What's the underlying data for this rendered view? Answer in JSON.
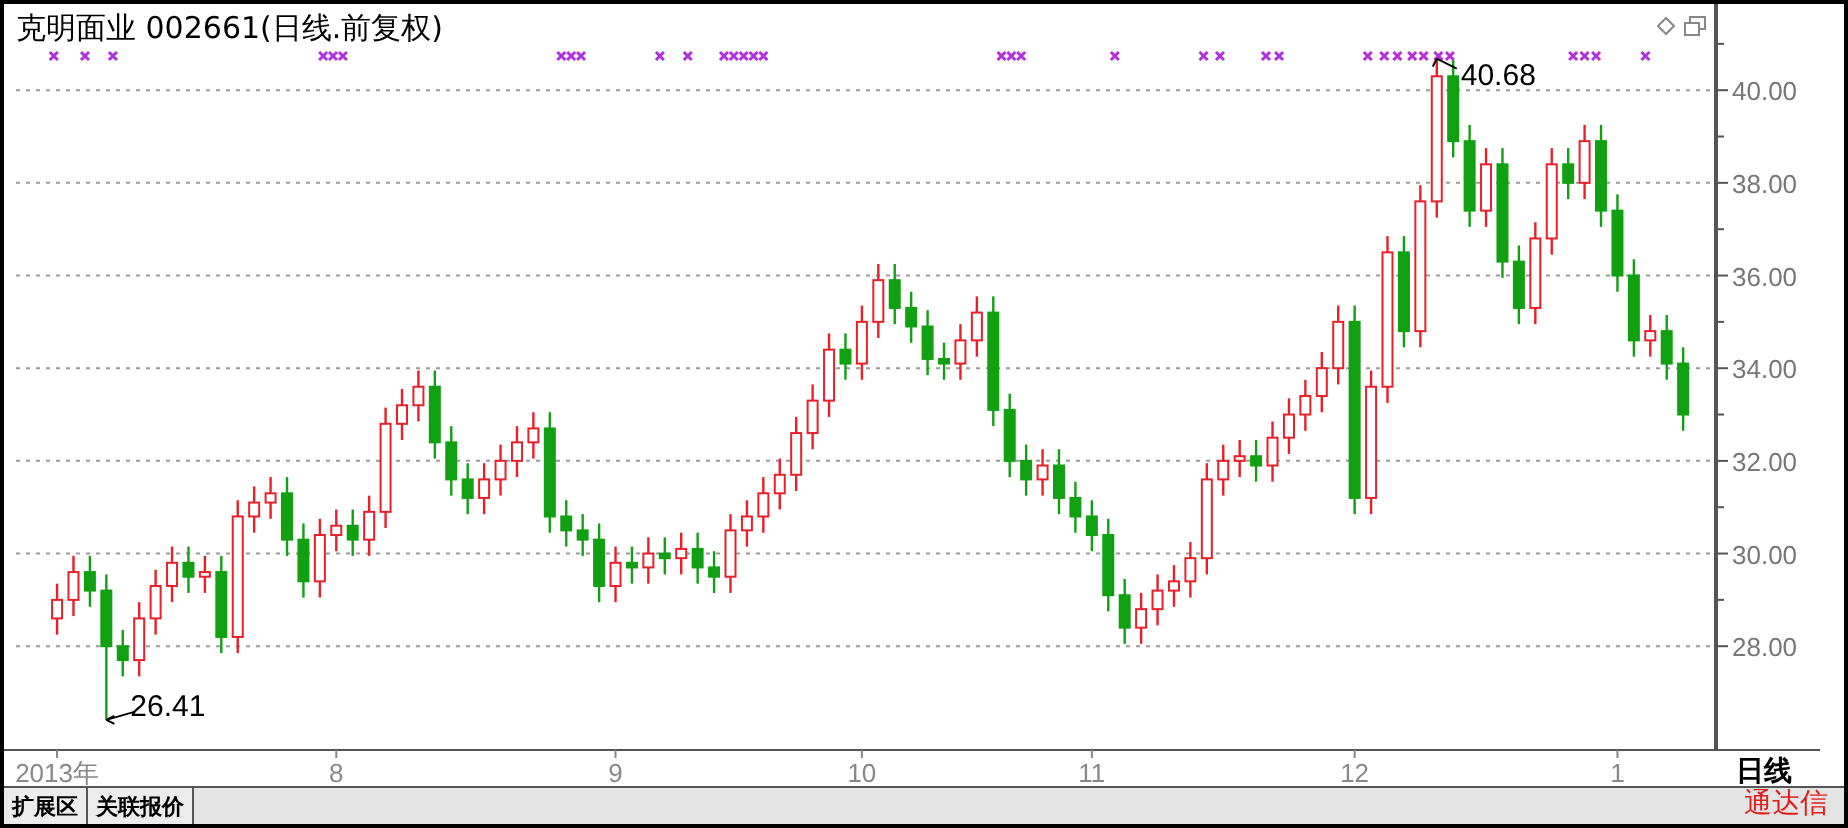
{
  "chart": {
    "title": "克明面业 002661(日线.前复权)",
    "chart_data": {
      "type": "candlestick",
      "grid": true,
      "ylim": [
        25.76,
        41.86
      ],
      "categories": [
        "2013年",
        null,
        null,
        null,
        null,
        null,
        null,
        null,
        null,
        null,
        null,
        null,
        null,
        null,
        null,
        null,
        null,
        "8",
        null,
        null,
        null,
        null,
        null,
        null,
        null,
        null,
        null,
        null,
        null,
        null,
        null,
        null,
        null,
        null,
        "9",
        null,
        null,
        null,
        null,
        null,
        null,
        null,
        null,
        null,
        null,
        null,
        null,
        null,
        null,
        "10",
        null,
        null,
        null,
        null,
        null,
        null,
        null,
        null,
        null,
        null,
        null,
        null,
        null,
        "11",
        null,
        null,
        null,
        null,
        null,
        null,
        null,
        null,
        null,
        null,
        null,
        null,
        null,
        null,
        null,
        "12",
        null,
        null,
        null,
        null,
        null,
        null,
        null,
        null,
        null,
        null,
        null,
        null,
        null,
        null,
        null,
        "1",
        null,
        null,
        null,
        null
      ],
      "ohlc": [
        [
          28.6,
          29.35,
          28.25,
          29.0
        ],
        [
          29.0,
          29.95,
          28.65,
          29.6
        ],
        [
          29.6,
          29.95,
          28.85,
          29.2
        ],
        [
          29.2,
          29.55,
          26.41,
          28.0
        ],
        [
          28.0,
          28.35,
          27.35,
          27.7
        ],
        [
          27.7,
          28.95,
          27.35,
          28.6
        ],
        [
          28.6,
          29.65,
          28.25,
          29.3
        ],
        [
          29.3,
          30.15,
          28.95,
          29.8
        ],
        [
          29.8,
          30.15,
          29.15,
          29.5
        ],
        [
          29.5,
          29.95,
          29.15,
          29.6
        ],
        [
          29.6,
          29.95,
          27.85,
          28.2
        ],
        [
          28.2,
          31.15,
          27.85,
          30.8
        ],
        [
          30.8,
          31.45,
          30.45,
          31.1
        ],
        [
          31.1,
          31.65,
          30.75,
          31.3
        ],
        [
          31.3,
          31.65,
          29.95,
          30.3
        ],
        [
          30.3,
          30.65,
          29.05,
          29.4
        ],
        [
          29.4,
          30.75,
          29.05,
          30.4
        ],
        [
          30.4,
          30.95,
          30.05,
          30.6
        ],
        [
          30.6,
          30.95,
          29.95,
          30.3
        ],
        [
          30.3,
          31.25,
          29.95,
          30.9
        ],
        [
          30.9,
          33.15,
          30.55,
          32.8
        ],
        [
          32.8,
          33.55,
          32.45,
          33.2
        ],
        [
          33.2,
          33.95,
          32.85,
          33.6
        ],
        [
          33.6,
          33.95,
          32.05,
          32.4
        ],
        [
          32.4,
          32.75,
          31.25,
          31.6
        ],
        [
          31.6,
          31.95,
          30.85,
          31.2
        ],
        [
          31.2,
          31.95,
          30.85,
          31.6
        ],
        [
          31.6,
          32.35,
          31.25,
          32.0
        ],
        [
          32.0,
          32.75,
          31.65,
          32.4
        ],
        [
          32.4,
          33.05,
          32.05,
          32.7
        ],
        [
          32.7,
          33.05,
          30.45,
          30.8
        ],
        [
          30.8,
          31.15,
          30.15,
          30.5
        ],
        [
          30.5,
          30.85,
          29.95,
          30.3
        ],
        [
          30.3,
          30.65,
          28.95,
          29.3
        ],
        [
          29.3,
          30.15,
          28.95,
          29.8
        ],
        [
          29.8,
          30.15,
          29.35,
          29.7
        ],
        [
          29.7,
          30.35,
          29.35,
          30.0
        ],
        [
          30.0,
          30.35,
          29.55,
          29.9
        ],
        [
          29.9,
          30.45,
          29.55,
          30.1
        ],
        [
          30.1,
          30.45,
          29.35,
          29.7
        ],
        [
          29.7,
          30.05,
          29.15,
          29.5
        ],
        [
          29.5,
          30.85,
          29.15,
          30.5
        ],
        [
          30.5,
          31.15,
          30.15,
          30.8
        ],
        [
          30.8,
          31.65,
          30.45,
          31.3
        ],
        [
          31.3,
          32.05,
          30.95,
          31.7
        ],
        [
          31.7,
          32.95,
          31.35,
          32.6
        ],
        [
          32.6,
          33.65,
          32.25,
          33.3
        ],
        [
          33.3,
          34.75,
          32.95,
          34.4
        ],
        [
          34.4,
          34.75,
          33.75,
          34.1
        ],
        [
          34.1,
          35.35,
          33.75,
          35.0
        ],
        [
          35.0,
          36.25,
          34.65,
          35.9
        ],
        [
          35.9,
          36.25,
          34.95,
          35.3
        ],
        [
          35.3,
          35.65,
          34.55,
          34.9
        ],
        [
          34.9,
          35.25,
          33.85,
          34.2
        ],
        [
          34.2,
          34.55,
          33.75,
          34.1
        ],
        [
          34.1,
          34.95,
          33.75,
          34.6
        ],
        [
          34.6,
          35.55,
          34.25,
          35.2
        ],
        [
          35.2,
          35.55,
          32.75,
          33.1
        ],
        [
          33.1,
          33.45,
          31.65,
          32.0
        ],
        [
          32.0,
          32.35,
          31.25,
          31.6
        ],
        [
          31.6,
          32.25,
          31.25,
          31.9
        ],
        [
          31.9,
          32.25,
          30.85,
          31.2
        ],
        [
          31.2,
          31.55,
          30.45,
          30.8
        ],
        [
          30.8,
          31.15,
          30.05,
          30.4
        ],
        [
          30.4,
          30.75,
          28.75,
          29.1
        ],
        [
          29.1,
          29.45,
          28.05,
          28.4
        ],
        [
          28.4,
          29.15,
          28.05,
          28.8
        ],
        [
          28.8,
          29.55,
          28.45,
          29.2
        ],
        [
          29.2,
          29.75,
          28.85,
          29.4
        ],
        [
          29.4,
          30.25,
          29.05,
          29.9
        ],
        [
          29.9,
          31.95,
          29.55,
          31.6
        ],
        [
          31.6,
          32.35,
          31.25,
          32.0
        ],
        [
          32.0,
          32.45,
          31.65,
          32.1
        ],
        [
          32.1,
          32.45,
          31.55,
          31.9
        ],
        [
          31.9,
          32.85,
          31.55,
          32.5
        ],
        [
          32.5,
          33.35,
          32.15,
          33.0
        ],
        [
          33.0,
          33.75,
          32.65,
          33.4
        ],
        [
          33.4,
          34.35,
          33.05,
          34.0
        ],
        [
          34.0,
          35.35,
          33.65,
          35.0
        ],
        [
          35.0,
          35.35,
          30.85,
          31.2
        ],
        [
          31.2,
          33.95,
          30.85,
          33.6
        ],
        [
          33.6,
          36.85,
          33.25,
          36.5
        ],
        [
          36.5,
          36.85,
          34.45,
          34.8
        ],
        [
          34.8,
          37.95,
          34.45,
          37.6
        ],
        [
          37.6,
          40.68,
          37.25,
          40.3
        ],
        [
          40.3,
          40.65,
          38.55,
          38.9
        ],
        [
          38.9,
          39.25,
          37.05,
          37.4
        ],
        [
          37.4,
          38.75,
          37.05,
          38.4
        ],
        [
          38.4,
          38.75,
          35.95,
          36.3
        ],
        [
          36.3,
          36.65,
          34.95,
          35.3
        ],
        [
          35.3,
          37.15,
          34.95,
          36.8
        ],
        [
          36.8,
          38.75,
          36.45,
          38.4
        ],
        [
          38.4,
          38.75,
          37.65,
          38.0
        ],
        [
          38.0,
          39.25,
          37.65,
          38.9
        ],
        [
          38.9,
          39.25,
          37.05,
          37.4
        ],
        [
          37.4,
          37.75,
          35.65,
          36.0
        ],
        [
          36.0,
          36.35,
          34.25,
          34.6
        ],
        [
          34.6,
          35.15,
          34.25,
          34.8
        ],
        [
          34.8,
          35.15,
          33.75,
          34.1
        ],
        [
          34.1,
          34.45,
          32.65,
          33.0
        ]
      ],
      "yticks": [
        {
          "value": 28,
          "label": "28.00"
        },
        {
          "value": 30,
          "label": "30.00"
        },
        {
          "value": 32,
          "label": "32.00"
        },
        {
          "value": 34,
          "label": "34.00"
        },
        {
          "value": 36,
          "label": "36.00"
        },
        {
          "value": 38,
          "label": "38.00"
        },
        {
          "value": 40,
          "label": "40.00"
        }
      ],
      "annotations": [
        "26.41",
        "40.68"
      ]
    }
  },
  "period_label": "日线",
  "tabs": [
    {
      "label": "扩展区"
    },
    {
      "label": "关联报价"
    }
  ],
  "brand": "通达信"
}
